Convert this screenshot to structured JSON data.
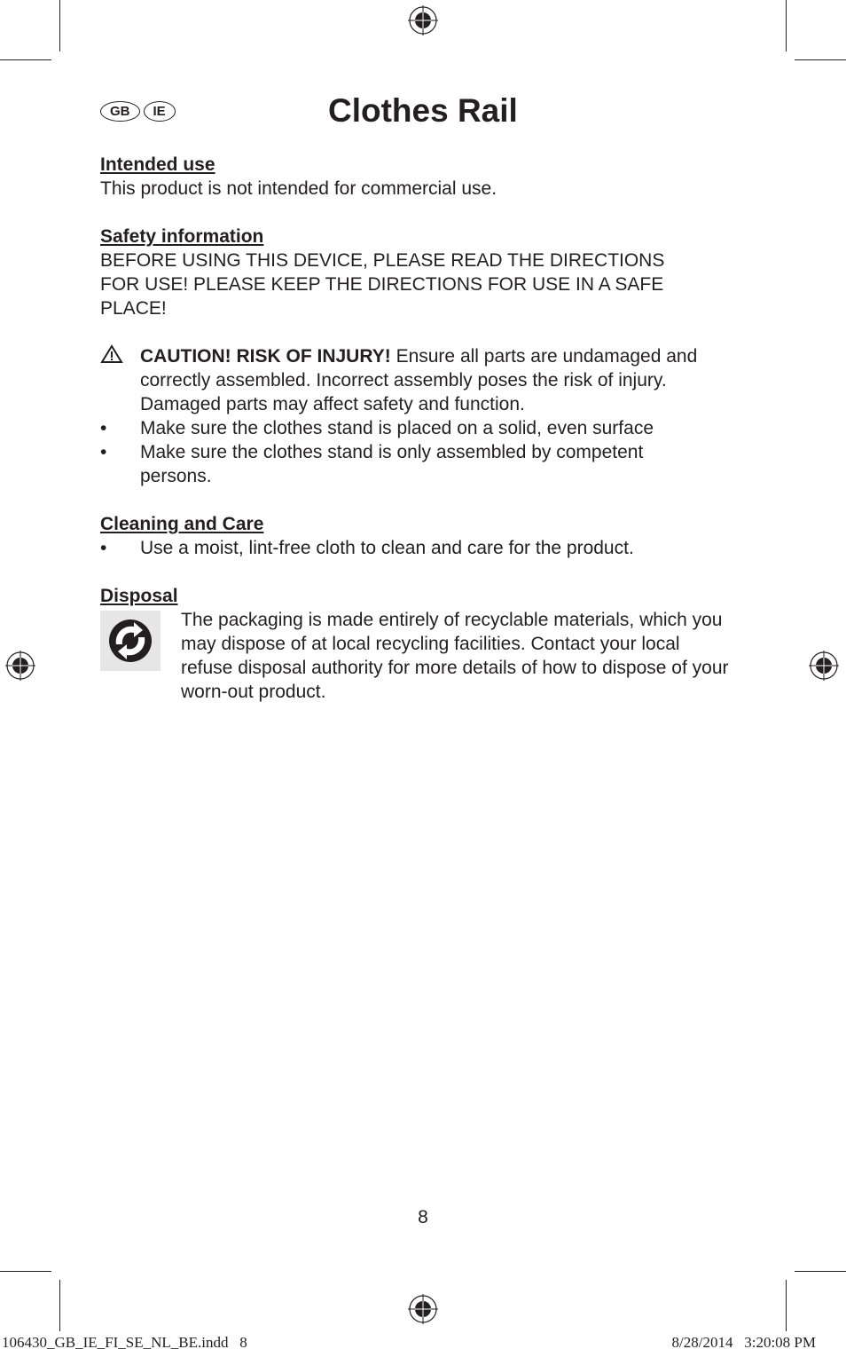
{
  "header": {
    "badges": [
      "GB",
      "IE"
    ],
    "title": "Clothes Rail"
  },
  "sections": {
    "intended": {
      "heading": "Intended use",
      "text": "This product is not intended for commercial use."
    },
    "safety": {
      "heading": "Safety information",
      "lines": [
        "BEFORE USING THIS DEVICE, PLEASE READ THE DIRECTIONS",
        "FOR USE! PLEASE KEEP THE DIRECTIONS FOR USE IN A SAFE",
        "PLACE!"
      ],
      "caution_bold": "CAUTION! RISK OF INJURY!",
      "caution_text": " Ensure all parts are undamaged and correctly assembled. Incorrect assembly poses the risk of injury. Damaged parts may affect safety and function.",
      "bullet_char": "•",
      "bullets": [
        "Make sure the clothes stand is placed on a solid, even surface",
        "Make sure the clothes stand is only assembled by competent persons."
      ]
    },
    "cleaning": {
      "heading": "Cleaning and Care",
      "bullets": [
        "Use a moist, lint-free cloth to clean and care for the product."
      ]
    },
    "disposal": {
      "heading": "Disposal",
      "icon": "green-dot-recycling-icon",
      "text": "The packaging is made entirely of recyclable materials, which you may dispose of at local recycling facilities. Contact your local refuse disposal authority for more details of how to dispose of your worn-out product."
    }
  },
  "footer": {
    "page_number": "8",
    "slug_file": "106430_GB_IE_FI_SE_NL_BE.indd   8",
    "slug_date": "8/28/2014   3:20:08 PM"
  }
}
